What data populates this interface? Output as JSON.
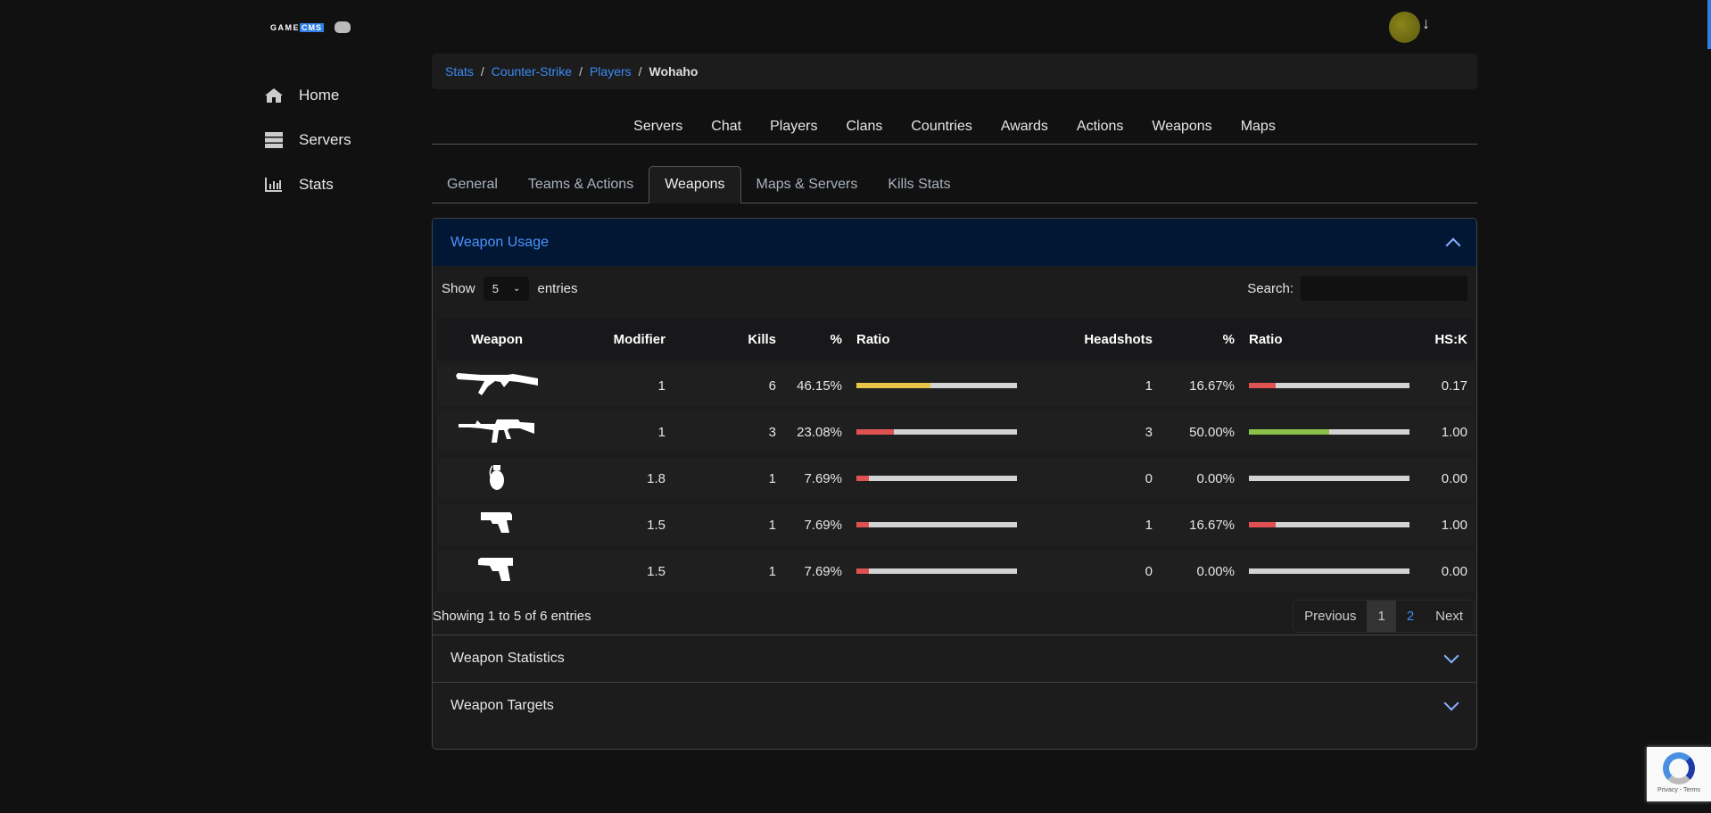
{
  "brand": {
    "logo_text_1": "GAME",
    "logo_text_2": "CMS"
  },
  "sidebar": {
    "items": [
      {
        "label": "Home",
        "icon": "home-icon"
      },
      {
        "label": "Servers",
        "icon": "server-icon"
      },
      {
        "label": "Stats",
        "icon": "chart-icon"
      }
    ]
  },
  "header": {
    "avatar_arrow": "↓"
  },
  "breadcrumb": {
    "items": [
      "Stats",
      "Counter-Strike",
      "Players"
    ],
    "current": "Wohaho",
    "separator": "/"
  },
  "topnav": [
    "Servers",
    "Chat",
    "Players",
    "Clans",
    "Countries",
    "Awards",
    "Actions",
    "Weapons",
    "Maps"
  ],
  "tabs": [
    "General",
    "Teams & Actions",
    "Weapons",
    "Maps & Servers",
    "Kills Stats"
  ],
  "active_tab": "Weapons",
  "card": {
    "title": "Weapon Usage",
    "show_label": "Show",
    "entries_value": "5",
    "entries_label": "entries",
    "search_label": "Search:",
    "search_value": "",
    "columns": [
      "Weapon",
      "Modifier",
      "Kills",
      "%",
      "Ratio",
      "Headshots",
      "%",
      "Ratio",
      "HS:K"
    ],
    "rows": [
      {
        "weapon": "ak47-icon",
        "modifier": "1",
        "kills": "6",
        "pct": "46.15%",
        "ratio": 46.15,
        "ratio_color": "#e8c547",
        "hs": "1",
        "hs_pct": "16.67%",
        "hs_ratio": 16.67,
        "hs_color": "#e05252",
        "hsk": "0.17"
      },
      {
        "weapon": "m4a1-icon",
        "modifier": "1",
        "kills": "3",
        "pct": "23.08%",
        "ratio": 23.08,
        "ratio_color": "#e05252",
        "hs": "3",
        "hs_pct": "50.00%",
        "hs_ratio": 50,
        "hs_color": "#8bc34a",
        "hsk": "1.00"
      },
      {
        "weapon": "grenade-icon",
        "modifier": "1.8",
        "kills": "1",
        "pct": "7.69%",
        "ratio": 7.69,
        "ratio_color": "#e05252",
        "hs": "0",
        "hs_pct": "0.00%",
        "hs_ratio": 0,
        "hs_color": "#e05252",
        "hsk": "0.00"
      },
      {
        "weapon": "glock-icon",
        "modifier": "1.5",
        "kills": "1",
        "pct": "7.69%",
        "ratio": 7.69,
        "ratio_color": "#e05252",
        "hs": "1",
        "hs_pct": "16.67%",
        "hs_ratio": 16.67,
        "hs_color": "#e05252",
        "hsk": "1.00"
      },
      {
        "weapon": "pistol-icon",
        "modifier": "1.5",
        "kills": "1",
        "pct": "7.69%",
        "ratio": 7.69,
        "ratio_color": "#e05252",
        "hs": "0",
        "hs_pct": "0.00%",
        "hs_ratio": 0,
        "hs_color": "#e05252",
        "hsk": "0.00"
      }
    ],
    "info": "Showing 1 to 5 of 6 entries",
    "pagination": {
      "previous": "Previous",
      "pages": [
        "1",
        "2"
      ],
      "current": "1",
      "next": "Next"
    }
  },
  "accordions": [
    "Weapon Statistics",
    "Weapon Targets"
  ],
  "recaptcha": {
    "text": "Privacy - Terms"
  }
}
